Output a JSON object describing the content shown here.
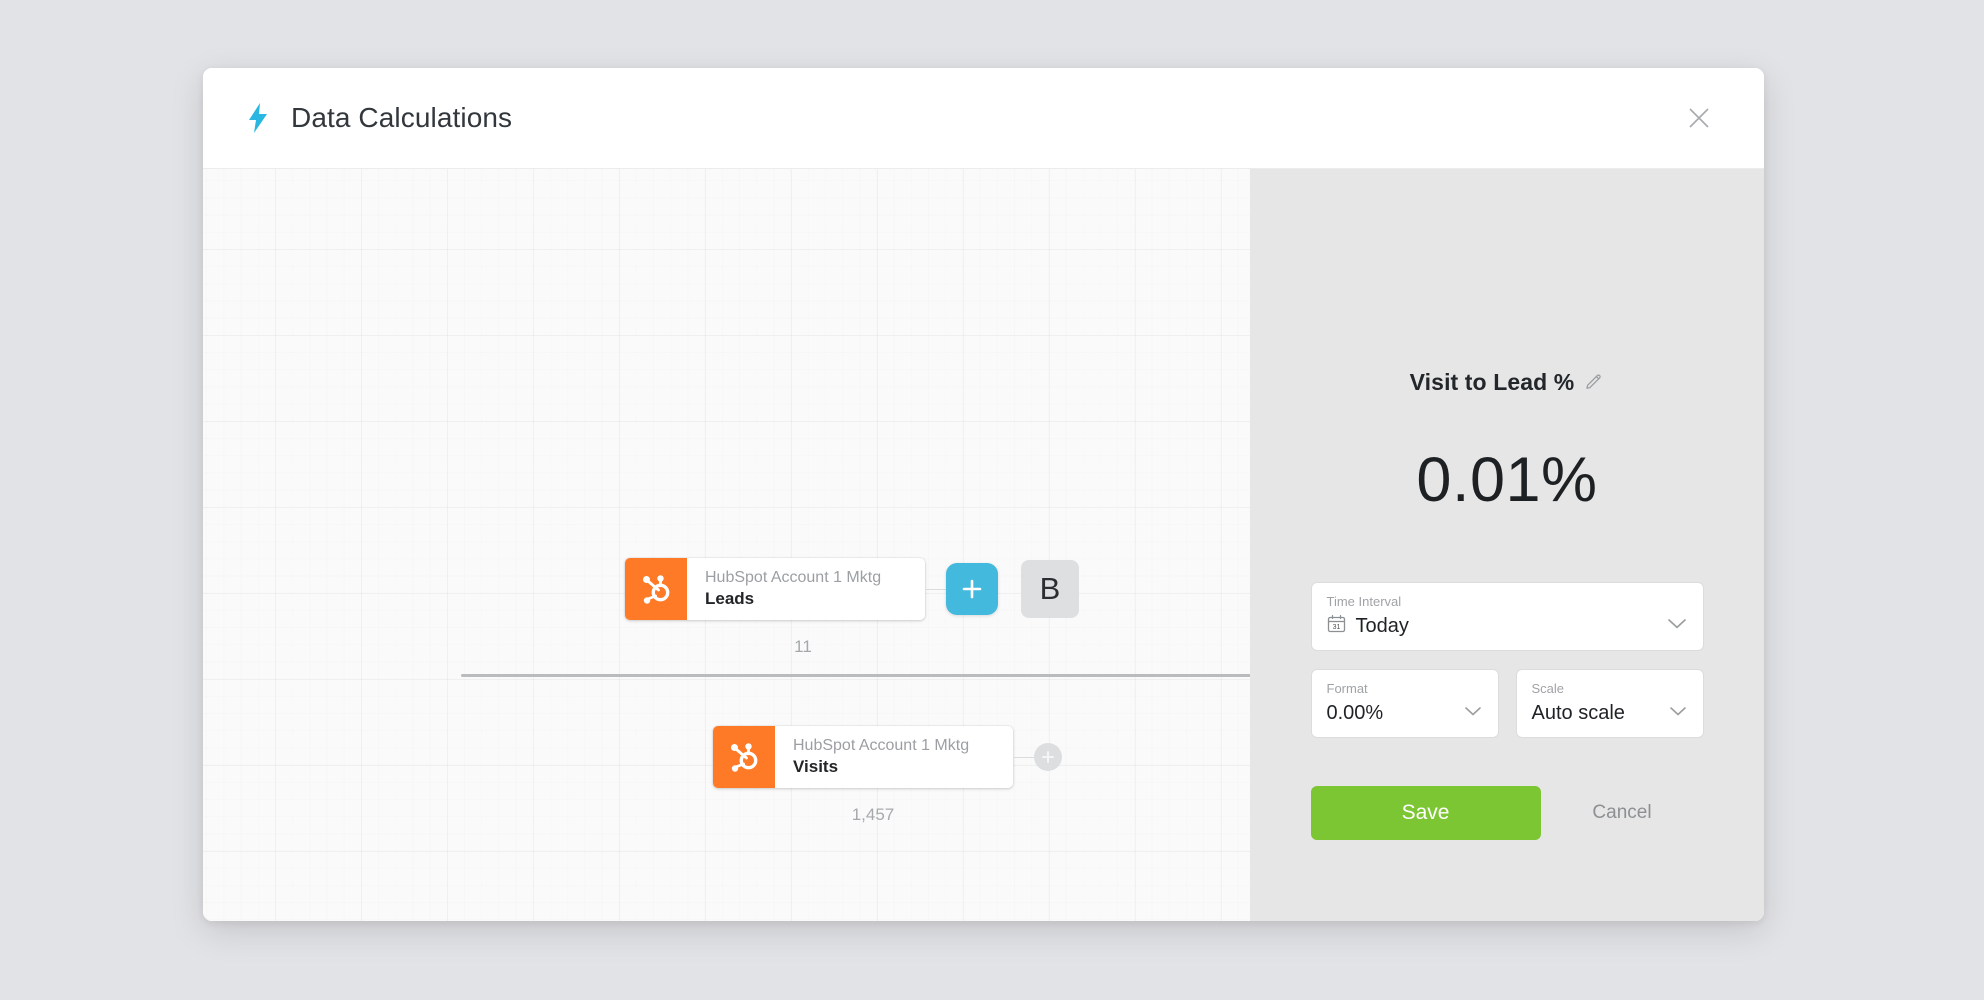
{
  "window": {
    "title": "Data Calculations",
    "title_icon": "lightning-bolt-icon",
    "close_icon": "close-icon",
    "accent_cyan": "#43b9dd",
    "accent_orange": "#ff7a26",
    "accent_green": "#7dc633",
    "page_background": "#e2e3e6",
    "panel_background": "#e6e6e6",
    "canvas_background": "#fafafa"
  },
  "canvas": {
    "operator_equals": "=",
    "numerator": {
      "account": "HubSpot Account 1 Mktg",
      "metric": "Leads",
      "value": "11",
      "logo_icon": "hubspot-logo-icon",
      "add_button_label": "+"
    },
    "denominator": {
      "account": "HubSpot Account 1 Mktg",
      "metric": "Visits",
      "value": "1,457",
      "logo_icon": "hubspot-logo-icon",
      "add_button_label": "+"
    },
    "empty_slot_label": "B"
  },
  "panel": {
    "title": "Visit to Lead %",
    "edit_icon": "pencil-icon",
    "result_value": "0.01%",
    "fields": {
      "time_interval": {
        "label": "Time Interval",
        "value": "Today",
        "icon": "calendar-icon",
        "calendar_day": "31"
      },
      "format": {
        "label": "Format",
        "value": "0.00%"
      },
      "scale": {
        "label": "Scale",
        "value": "Auto scale"
      }
    },
    "save_label": "Save",
    "cancel_label": "Cancel"
  }
}
